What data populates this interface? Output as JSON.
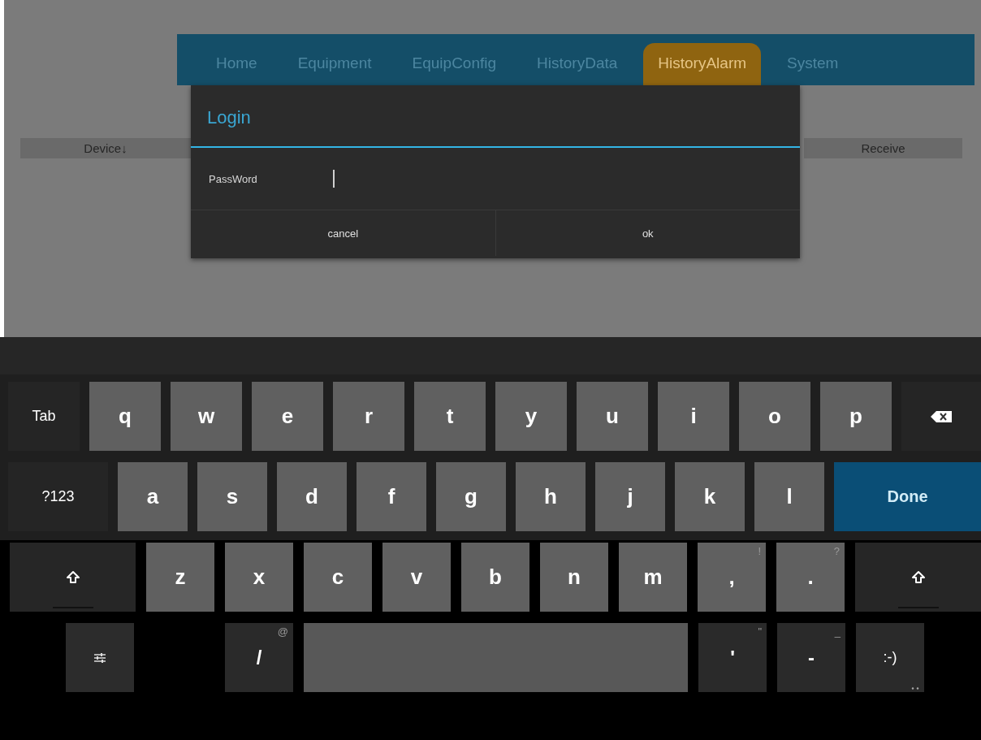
{
  "nav": {
    "tabs": [
      {
        "label": "Home",
        "selected": false
      },
      {
        "label": "Equipment",
        "selected": false
      },
      {
        "label": "EquipConfig",
        "selected": false
      },
      {
        "label": "HistoryData",
        "selected": false
      },
      {
        "label": "HistoryAlarm",
        "selected": true
      },
      {
        "label": "System",
        "selected": false
      }
    ]
  },
  "table": {
    "columns": [
      "Device↓",
      "Receive"
    ]
  },
  "dialog": {
    "title": "Login",
    "fields": [
      {
        "label": "PassWord",
        "focused": true
      }
    ],
    "buttons": [
      "cancel",
      "ok"
    ]
  },
  "keyboard": {
    "rows": [
      [
        {
          "kind": "function",
          "label": "Tab"
        },
        {
          "kind": "letter",
          "label": "q"
        },
        {
          "kind": "letter",
          "label": "w"
        },
        {
          "kind": "letter",
          "label": "e"
        },
        {
          "kind": "letter",
          "label": "r"
        },
        {
          "kind": "letter",
          "label": "t"
        },
        {
          "kind": "letter",
          "label": "y"
        },
        {
          "kind": "letter",
          "label": "u"
        },
        {
          "kind": "letter",
          "label": "i"
        },
        {
          "kind": "letter",
          "label": "o"
        },
        {
          "kind": "letter",
          "label": "p"
        },
        {
          "kind": "backspace"
        }
      ],
      [
        {
          "kind": "function",
          "label": "?123"
        },
        {
          "kind": "letter",
          "label": "a"
        },
        {
          "kind": "letter",
          "label": "s"
        },
        {
          "kind": "letter",
          "label": "d"
        },
        {
          "kind": "letter",
          "label": "f"
        },
        {
          "kind": "letter",
          "label": "g"
        },
        {
          "kind": "letter",
          "label": "h"
        },
        {
          "kind": "letter",
          "label": "j"
        },
        {
          "kind": "letter",
          "label": "k"
        },
        {
          "kind": "letter",
          "label": "l"
        },
        {
          "kind": "action",
          "label": "Done"
        }
      ],
      [
        {
          "kind": "shift"
        },
        {
          "kind": "letter",
          "label": "z"
        },
        {
          "kind": "letter",
          "label": "x"
        },
        {
          "kind": "letter",
          "label": "c"
        },
        {
          "kind": "letter",
          "label": "v"
        },
        {
          "kind": "letter",
          "label": "b"
        },
        {
          "kind": "letter",
          "label": "n"
        },
        {
          "kind": "letter",
          "label": "m"
        },
        {
          "kind": "letter",
          "label": ",",
          "hint": "!"
        },
        {
          "kind": "letter",
          "label": ".",
          "hint": "?"
        },
        {
          "kind": "shift"
        }
      ],
      [
        {
          "kind": "settings"
        },
        {
          "kind": "symbol",
          "label": "/",
          "hint": "@"
        },
        {
          "kind": "space"
        },
        {
          "kind": "symbol",
          "label": "'",
          "hint": "\""
        },
        {
          "kind": "symbol",
          "label": "-",
          "hint": "_"
        },
        {
          "kind": "symbol",
          "label": ":-)",
          "more": true
        }
      ]
    ]
  }
}
